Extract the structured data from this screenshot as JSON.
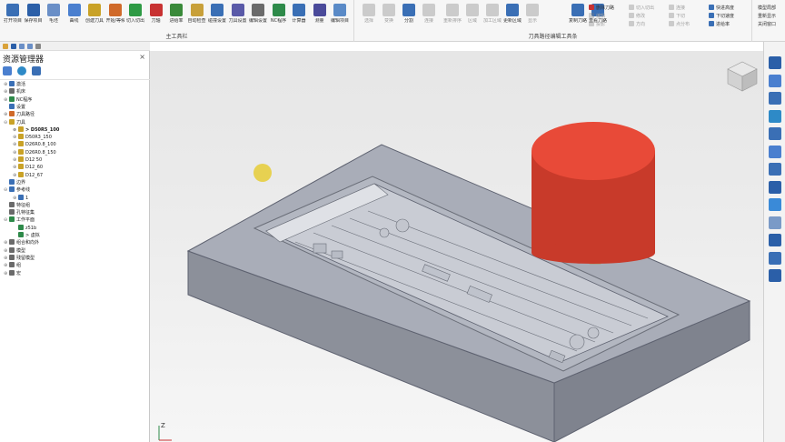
{
  "ribbon": {
    "main_group_label": "主工具栏",
    "toolpath_group_label": "刀具路径编辑工具条",
    "main_tools": [
      {
        "label": "打开项目",
        "color": "#3a6fb5"
      },
      {
        "label": "保存项目",
        "color": "#2b5fa8"
      },
      {
        "label": "毛坯",
        "color": "#6a8fc7"
      },
      {
        "label": "曲线",
        "color": "#4a7fcf"
      },
      {
        "label": "创建刀具",
        "color": "#c9a227"
      },
      {
        "label": "开始/等候",
        "color": "#d06a2a"
      },
      {
        "label": "切入切出",
        "color": "#2e9a44"
      },
      {
        "label": "刀轴",
        "color": "#c83232"
      },
      {
        "label": "进给率",
        "color": "#3a8a3a"
      },
      {
        "label": "自动检查",
        "color": "#c8a03a"
      },
      {
        "label": "碰撞设置",
        "color": "#3a6fb5"
      },
      {
        "label": "刀具设置",
        "color": "#5a5aa8"
      },
      {
        "label": "编辑设置",
        "color": "#6a6a6a"
      },
      {
        "label": "NC程序",
        "color": "#2e8a4a"
      },
      {
        "label": "计算器",
        "color": "#3a6fb5"
      },
      {
        "label": "测量",
        "color": "#4a4a9a"
      },
      {
        "label": "编辑项目",
        "color": "#5a8ac7"
      }
    ],
    "path_tools": [
      {
        "label": "选择",
        "color": "#7a7a7a"
      },
      {
        "label": "变换",
        "color": "#7a7a7a"
      },
      {
        "label": "分割",
        "color": "#3a6fb5"
      },
      {
        "label": "连接",
        "color": "#7a7a7a"
      },
      {
        "label": "重新排序",
        "color": "#7a7a7a"
      },
      {
        "label": "区域",
        "color": "#7a7a7a"
      },
      {
        "label": "加工区域",
        "color": "#7a7a7a"
      },
      {
        "label": "更新区域",
        "color": "#3a6fb5"
      },
      {
        "label": "显示",
        "color": "#7a7a7a"
      },
      {
        "label": "复制刀路",
        "color": "#3a6fb5"
      },
      {
        "label": "查看刀路",
        "color": "#3a6fb5"
      }
    ],
    "small_tools": [
      {
        "label": "删除刀路",
        "color": "#c83232"
      },
      {
        "label": "切入切出",
        "color": "#7a7a7a"
      },
      {
        "label": "连接",
        "color": "#7a7a7a"
      },
      {
        "label": "快进高度",
        "color": "#3a6fb5"
      },
      {
        "label": "编辑",
        "color": "#7a7a7a"
      },
      {
        "label": "修改",
        "color": "#7a7a7a"
      },
      {
        "label": "下切",
        "color": "#7a7a7a"
      },
      {
        "label": "下切速度",
        "color": "#3a6fb5"
      },
      {
        "label": "投影",
        "color": "#7a7a7a"
      },
      {
        "label": "方向",
        "color": "#7a7a7a"
      },
      {
        "label": "点分布",
        "color": "#7a7a7a"
      },
      {
        "label": "进给率",
        "color": "#3a6fb5"
      }
    ],
    "far_right": [
      "模型局部",
      "重新显示",
      "关闭窗口"
    ]
  },
  "panel": {
    "title": "资源管理器",
    "close": "×"
  },
  "tree": [
    {
      "label": "激活",
      "indent": 0,
      "toggle": "⊕",
      "color": "#3a6fb5"
    },
    {
      "label": "机床",
      "indent": 0,
      "toggle": "⊕",
      "color": "#6a6a6a"
    },
    {
      "label": "NC程序",
      "indent": 0,
      "toggle": "⊕",
      "color": "#2e8a4a"
    },
    {
      "label": "设置",
      "indent": 0,
      "toggle": "",
      "color": "#3a6fb5"
    },
    {
      "label": "刀具路径",
      "indent": 0,
      "toggle": "⊕",
      "color": "#d06a2a"
    },
    {
      "label": "刀具",
      "indent": 0,
      "toggle": "⊖",
      "color": "#c9a227"
    },
    {
      "label": "> D50R5_100",
      "indent": 2,
      "toggle": "⊕",
      "color": "#c9a227",
      "bold": true
    },
    {
      "label": "D50R3_150",
      "indent": 2,
      "toggle": "⊕",
      "color": "#c9a227"
    },
    {
      "label": "D26R0.8_100",
      "indent": 2,
      "toggle": "⊕",
      "color": "#c9a227"
    },
    {
      "label": "D26R0.8_150",
      "indent": 2,
      "toggle": "⊕",
      "color": "#c9a227"
    },
    {
      "label": "D12 50",
      "indent": 2,
      "toggle": "⊕",
      "color": "#c9a227"
    },
    {
      "label": "D12_60",
      "indent": 2,
      "toggle": "⊕",
      "color": "#c9a227"
    },
    {
      "label": "D12_67",
      "indent": 2,
      "toggle": "⊕",
      "color": "#c9a227"
    },
    {
      "label": "边界",
      "indent": 0,
      "toggle": "",
      "color": "#3a6fb5"
    },
    {
      "label": "参考线",
      "indent": 0,
      "toggle": "⊖",
      "color": "#3a6fb5"
    },
    {
      "label": "1",
      "indent": 2,
      "toggle": "⊕",
      "color": "#3a6fb5"
    },
    {
      "label": "特征组",
      "indent": 0,
      "toggle": "",
      "color": "#6a6a6a"
    },
    {
      "label": "孔特征集",
      "indent": 0,
      "toggle": "",
      "color": "#6a6a6a"
    },
    {
      "label": "工作平面",
      "indent": 0,
      "toggle": "⊖",
      "color": "#2e8a4a"
    },
    {
      "label": "z51b",
      "indent": 2,
      "toggle": "",
      "color": "#2e8a4a"
    },
    {
      "label": "> 虚拟",
      "indent": 2,
      "toggle": "",
      "color": "#2e8a4a"
    },
    {
      "label": "组合和向外",
      "indent": 0,
      "toggle": "⊕",
      "color": "#6a6a6a"
    },
    {
      "label": "模型",
      "indent": 0,
      "toggle": "⊕",
      "color": "#6a6a6a"
    },
    {
      "label": "残留模型",
      "indent": 0,
      "toggle": "⊕",
      "color": "#6a6a6a"
    },
    {
      "label": "组",
      "indent": 0,
      "toggle": "⊕",
      "color": "#6a6a6a"
    },
    {
      "label": "宏",
      "indent": 0,
      "toggle": "⊕",
      "color": "#6a6a6a"
    }
  ],
  "viewport": {
    "axis_label": "Z"
  },
  "colors": {
    "tool": "#e84a38",
    "tool_shade": "#c83a2a",
    "model_top": "#a9adb8",
    "model_side": "#7f838e",
    "model_front": "#8c909a",
    "accent": "#2b5fa8"
  }
}
